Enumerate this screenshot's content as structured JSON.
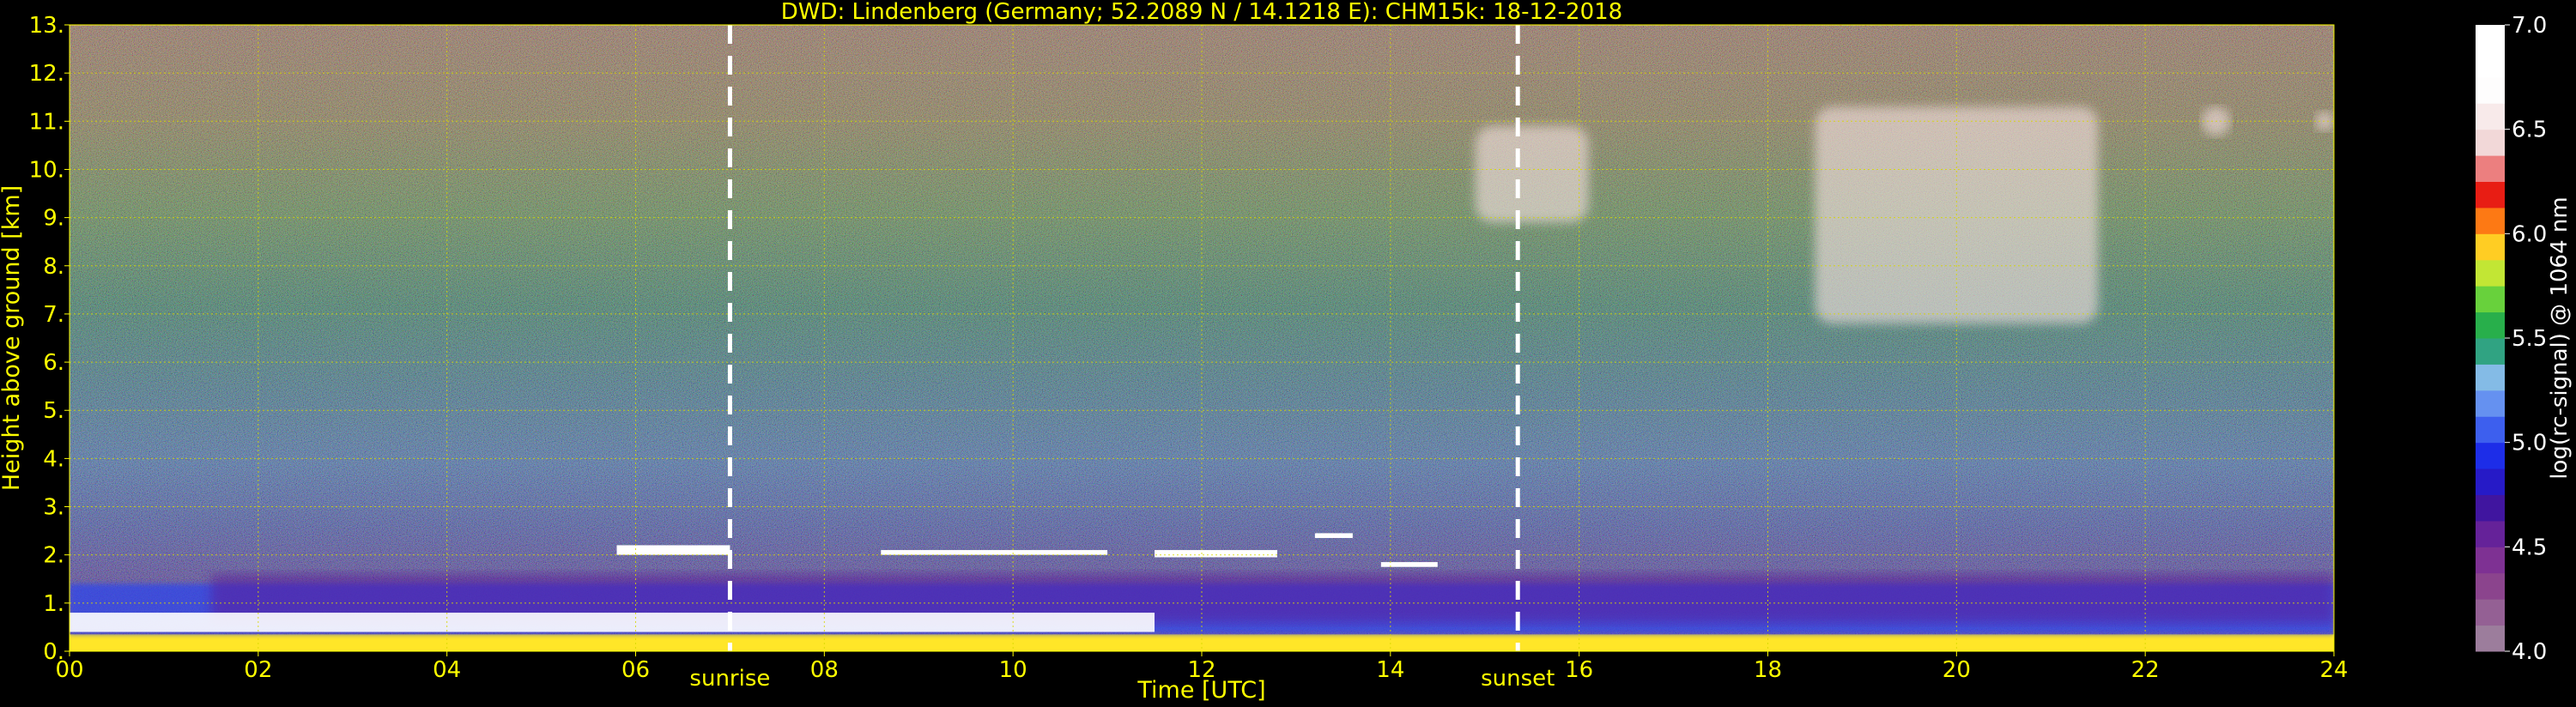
{
  "chart_data": {
    "type": "heatmap",
    "title": "DWD: Lindenberg (Germany; 52.2089 N / 14.1218 E):     CHM15k: 18-12-2018",
    "xlabel": "Time [UTC]",
    "ylabel": "Height above ground [km]",
    "x_ticks": [
      "00",
      "02",
      "04",
      "06",
      "08",
      "10",
      "12",
      "14",
      "16",
      "18",
      "20",
      "22",
      "24"
    ],
    "y_ticks": [
      "0.",
      "1.",
      "2.",
      "3.",
      "4.",
      "5.",
      "6.",
      "7.",
      "8.",
      "9.",
      "10.",
      "11.",
      "12.",
      "13."
    ],
    "xlim": [
      0,
      24
    ],
    "ylim": [
      0,
      13
    ],
    "grid": true,
    "colorbar": {
      "label": "log(rc-signal) @ 1064 nm",
      "range": [
        4.0,
        7.0
      ],
      "ticks": [
        "4.0",
        "4.5",
        "5.0",
        "5.5",
        "6.0",
        "6.5",
        "7.0"
      ]
    },
    "markers": [
      {
        "label": "sunrise",
        "x": 7.0
      },
      {
        "label": "sunset",
        "x": 15.35
      }
    ],
    "layers": [
      {
        "kind": "surface_layer",
        "x_start": 0,
        "x_end": 24,
        "y_bottom": 0,
        "y_top": 0.35,
        "value": 5.9
      },
      {
        "kind": "boundary_layer",
        "x_start": 0,
        "x_end": 24,
        "y_bottom": 0.35,
        "y_top": 1.4,
        "value": 5.0
      },
      {
        "kind": "residual_layer",
        "x_start": 1.5,
        "x_end": 24,
        "y_bottom": 0.6,
        "y_top": 1.6,
        "value": 4.6
      },
      {
        "kind": "stratocumulus",
        "x_start": 0,
        "x_end": 11.5,
        "y_bottom": 0.4,
        "y_top": 0.8,
        "value": 7.0
      },
      {
        "kind": "low_cloud",
        "x_start": 5.8,
        "x_end": 7.0,
        "y_bottom": 2.0,
        "y_top": 2.2,
        "value": 7.0
      },
      {
        "kind": "low_cloud",
        "x_start": 8.6,
        "x_end": 11.0,
        "y_bottom": 2.0,
        "y_top": 2.1,
        "value": 7.0
      },
      {
        "kind": "low_cloud",
        "x_start": 11.5,
        "x_end": 12.8,
        "y_bottom": 1.95,
        "y_top": 2.1,
        "value": 7.0
      },
      {
        "kind": "low_cloud",
        "x_start": 13.2,
        "x_end": 13.6,
        "y_bottom": 2.35,
        "y_top": 2.45,
        "value": 7.0
      },
      {
        "kind": "low_cloud",
        "x_start": 13.9,
        "x_end": 14.5,
        "y_bottom": 1.75,
        "y_top": 1.85,
        "value": 7.0
      },
      {
        "kind": "cirrus",
        "x_start": 14.9,
        "x_end": 16.1,
        "y_bottom": 8.9,
        "y_top": 10.9,
        "value": 6.5
      },
      {
        "kind": "cirrus",
        "x_start": 18.5,
        "x_end": 21.5,
        "y_bottom": 6.8,
        "y_top": 11.3,
        "value": 6.5
      },
      {
        "kind": "cirrus",
        "x_start": 22.6,
        "x_end": 22.9,
        "y_bottom": 10.7,
        "y_top": 11.3,
        "value": 6.5
      },
      {
        "kind": "cirrus",
        "x_start": 23.8,
        "x_end": 24,
        "y_bottom": 10.8,
        "y_top": 11.2,
        "value": 6.5
      }
    ]
  }
}
